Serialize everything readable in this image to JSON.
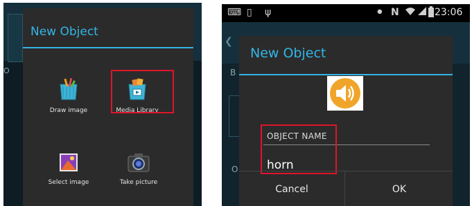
{
  "left": {
    "dialog_title": "New Object",
    "options": [
      {
        "label": "Draw image",
        "icon": "draw-image-icon"
      },
      {
        "label": "Media Library",
        "icon": "media-library-icon"
      },
      {
        "label": "Select image",
        "icon": "gallery-icon"
      },
      {
        "label": "Take picture",
        "icon": "camera-icon"
      }
    ],
    "bg_fragment": "O"
  },
  "right": {
    "status_bar": {
      "time": "23:06",
      "icons": [
        "keyboard-icon",
        "sim-icon",
        "usb-icon",
        "bluetooth-icon",
        "nfc-icon",
        "wifi-icon",
        "signal-icon",
        "battery-icon"
      ]
    },
    "dialog_title": "New Object",
    "object_icon": "speaker-icon",
    "field_label": "OBJECT NAME",
    "field_value": "horn",
    "buttons": {
      "cancel": "Cancel",
      "ok": "OK"
    },
    "bg_fragments": {
      "b": "B",
      "o": "O"
    }
  },
  "colors": {
    "accent": "#33b5e5",
    "highlight": "#e0142a",
    "dialog_bg": "#2b2b2b"
  }
}
